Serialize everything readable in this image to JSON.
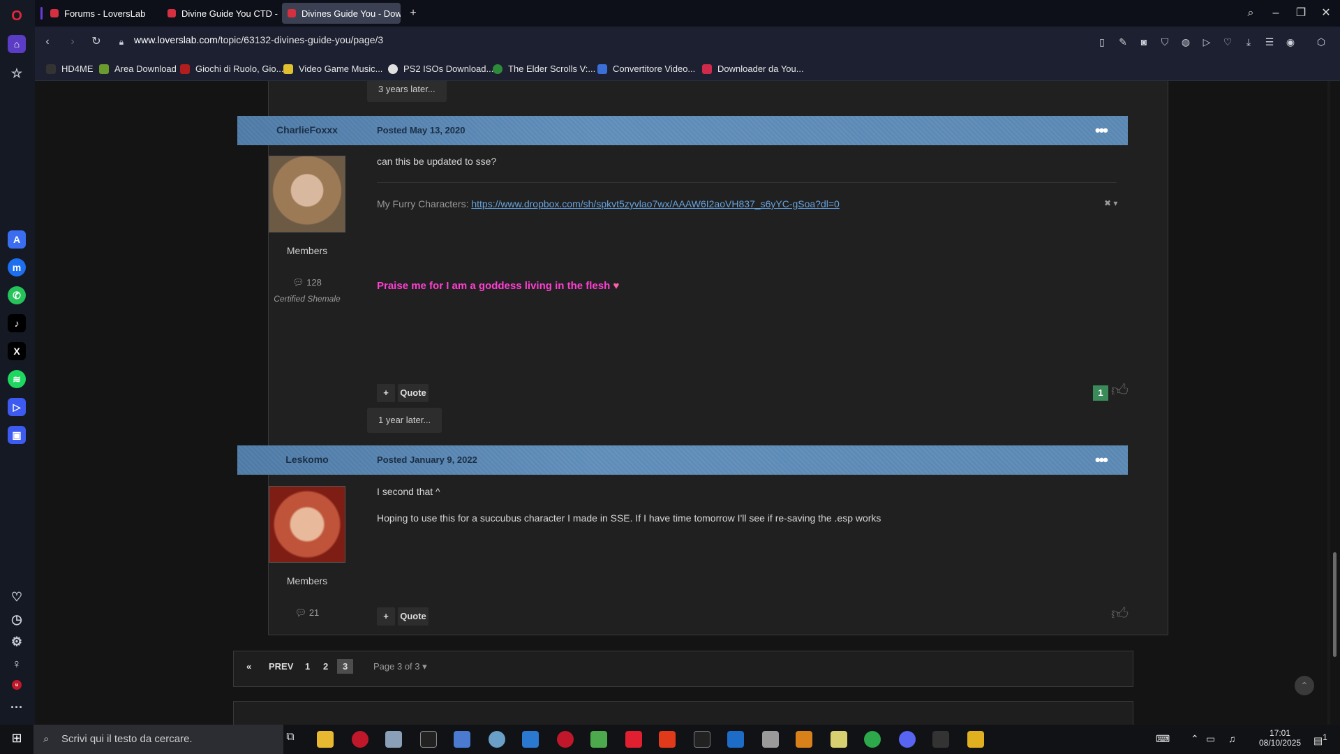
{
  "browser": {
    "tabs": [
      {
        "title": "Forums - LoversLab",
        "active": false
      },
      {
        "title": "Divine Guide You CTD - Sk",
        "active": false
      },
      {
        "title": "Divines Guide You - Down",
        "active": true
      }
    ],
    "url_host": "www.loverslab.com",
    "url_path": "/topic/63132-divines-guide-you/page/3",
    "bookmarks": [
      {
        "label": "HD4ME",
        "color": "#222"
      },
      {
        "label": "Area Download",
        "color": "#6b9b2e"
      },
      {
        "label": "Giochi di Ruolo, Gio...",
        "color": "#b21d1d"
      },
      {
        "label": "Video Game Music...",
        "color": "#e0c030"
      },
      {
        "label": "PS2 ISOs Download...",
        "color": "#e0e0e0"
      },
      {
        "label": "The Elder Scrolls V:...",
        "color": "#2e8b3a"
      },
      {
        "label": "Convertitore Video...",
        "color": "#3a6fd8"
      },
      {
        "label": "Downloader da You...",
        "color": "#d02a4a"
      }
    ]
  },
  "thread": {
    "gap1": "3 years later...",
    "gap2": "1 year later...",
    "posts": [
      {
        "author": "CharlieFoxxx",
        "posted": "Posted May 13, 2020",
        "group": "Members",
        "post_count": "128",
        "title": "Certified Shemale",
        "body": "can this be updated to sse?",
        "sig_label": "My Furry Characters: ",
        "sig_link": "https://www.dropbox.com/sh/spkvt5zyvlao7wx/AAAW6I2aoVH837_s6yYC-gSoa?dl=0",
        "praise": "Praise me for I am a goddess living in the flesh",
        "reputation": "1",
        "quote": "Quote"
      },
      {
        "author": "Leskomo",
        "posted": "Posted January 9, 2022",
        "group": "Members",
        "post_count": "21",
        "body1": "I second that ^",
        "body2": "Hoping to use this for a succubus character I made in SSE. If I have time tomorrow I'll see if re-saving the .esp works",
        "quote": "Quote"
      }
    ]
  },
  "pager": {
    "prev": "PREV",
    "pages": [
      "1",
      "2",
      "3"
    ],
    "current": "3",
    "page_of": "Page 3 of 3"
  },
  "taskbar": {
    "search_placeholder": "Scrivi qui il testo da cercare.",
    "time": "17:01",
    "date": "08/10/2025",
    "notif_count": "1"
  }
}
